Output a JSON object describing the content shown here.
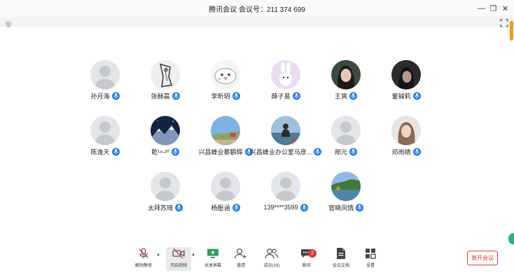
{
  "titlebar": {
    "title": "腾讯会议 会议号：211 374 699"
  },
  "window_controls": {
    "minimize": "—",
    "restore": "❐",
    "close": "✕"
  },
  "participants": [
    {
      "name": "孙月海",
      "avatar": "default-avatar"
    },
    {
      "name": "张赫晨",
      "avatar": "sketch-photo"
    },
    {
      "name": "李昕玥",
      "avatar": "cartoon-seal"
    },
    {
      "name": "薛子易",
      "avatar": "bunny-illustration"
    },
    {
      "name": "王爽",
      "avatar": "woman-photo"
    },
    {
      "name": "董铖莉",
      "avatar": "dark-portrait"
    },
    {
      "name": "陈逸天",
      "avatar": "default-avatar"
    },
    {
      "name": "乾¹⁹-²⁰",
      "avatar": "mountain-night"
    },
    {
      "name": "兴昌蜂业蔡鹏辉",
      "avatar": "sky-landscape"
    },
    {
      "name": "兴昌蜂业办公室马彦...",
      "avatar": "person-sea"
    },
    {
      "name": "邢元",
      "avatar": "default-avatar"
    },
    {
      "name": "邓雨晴",
      "avatar": "woman-hair"
    },
    {
      "name": "太拜苏琦",
      "avatar": "default-avatar"
    },
    {
      "name": "杨壓涵",
      "avatar": "default-avatar"
    },
    {
      "name": "139****3599",
      "avatar": "default-avatar"
    },
    {
      "name": "官晓风情",
      "avatar": "lake-landscape"
    }
  ],
  "toolbar": {
    "unmute_label": "解除静音",
    "video_label": "开启视频",
    "share_label": "共享屏幕",
    "invite_label": "邀请",
    "members_label": "成员(16)",
    "chat_label": "聊天",
    "chat_badge": "2",
    "docs_label": "会议文档",
    "settings_label": "设置",
    "caret": "▲"
  },
  "leave_button": {
    "label": "离开会议"
  },
  "colors": {
    "accent": "#1e7ff5",
    "danger": "#e53935"
  }
}
